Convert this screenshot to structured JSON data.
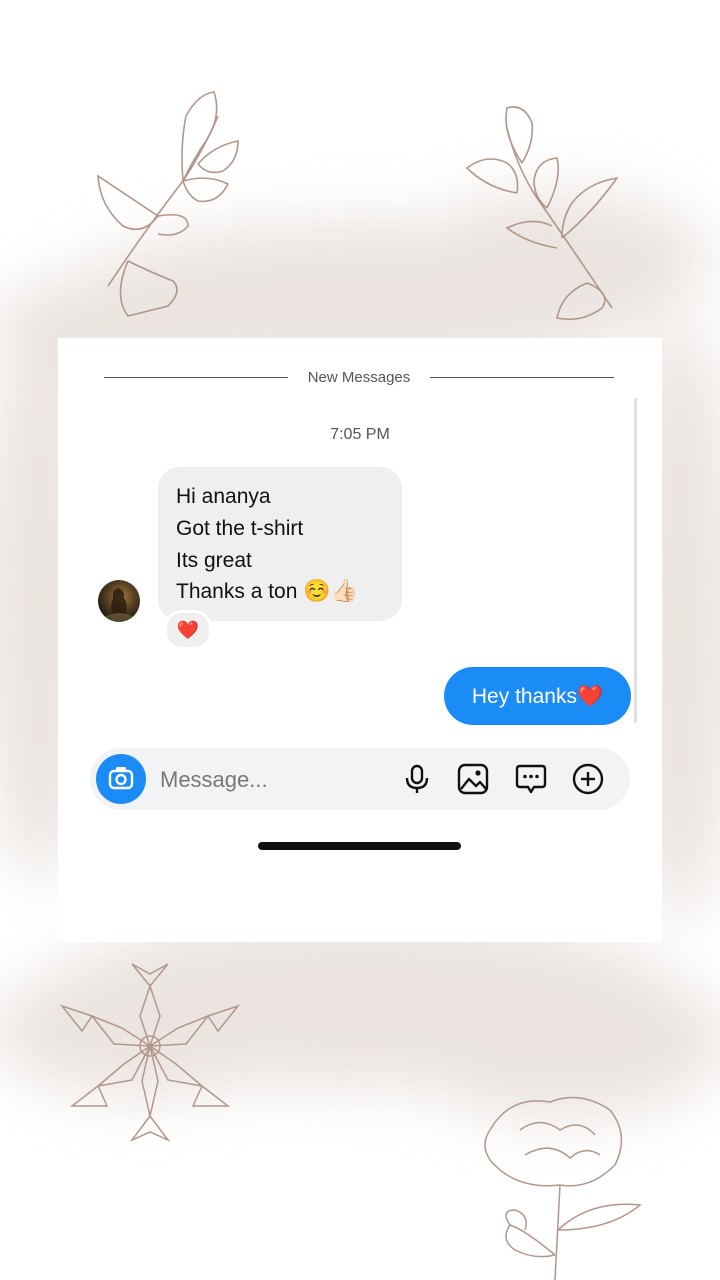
{
  "divider": {
    "label": "New Messages"
  },
  "timestamp": "7:05 PM",
  "incoming_message": {
    "lines": [
      "Hi ananya",
      "Got the t-shirt",
      "Its great",
      "Thanks a ton"
    ],
    "emojis": "☺️👍🏻",
    "reaction": "❤️"
  },
  "outgoing_message": {
    "text": "Hey thanks",
    "emoji": "❤️"
  },
  "composer": {
    "placeholder": "Message..."
  },
  "icons": {
    "camera": "camera-icon",
    "microphone": "microphone-icon",
    "gallery": "gallery-icon",
    "sticker": "chat-sticker-icon",
    "add": "plus-circle-icon"
  },
  "colors": {
    "accent": "#1b8cf5",
    "incoming_bubble": "#efefef",
    "composer_bg": "#f2f3f5",
    "decor_stroke": "#b3968a"
  }
}
